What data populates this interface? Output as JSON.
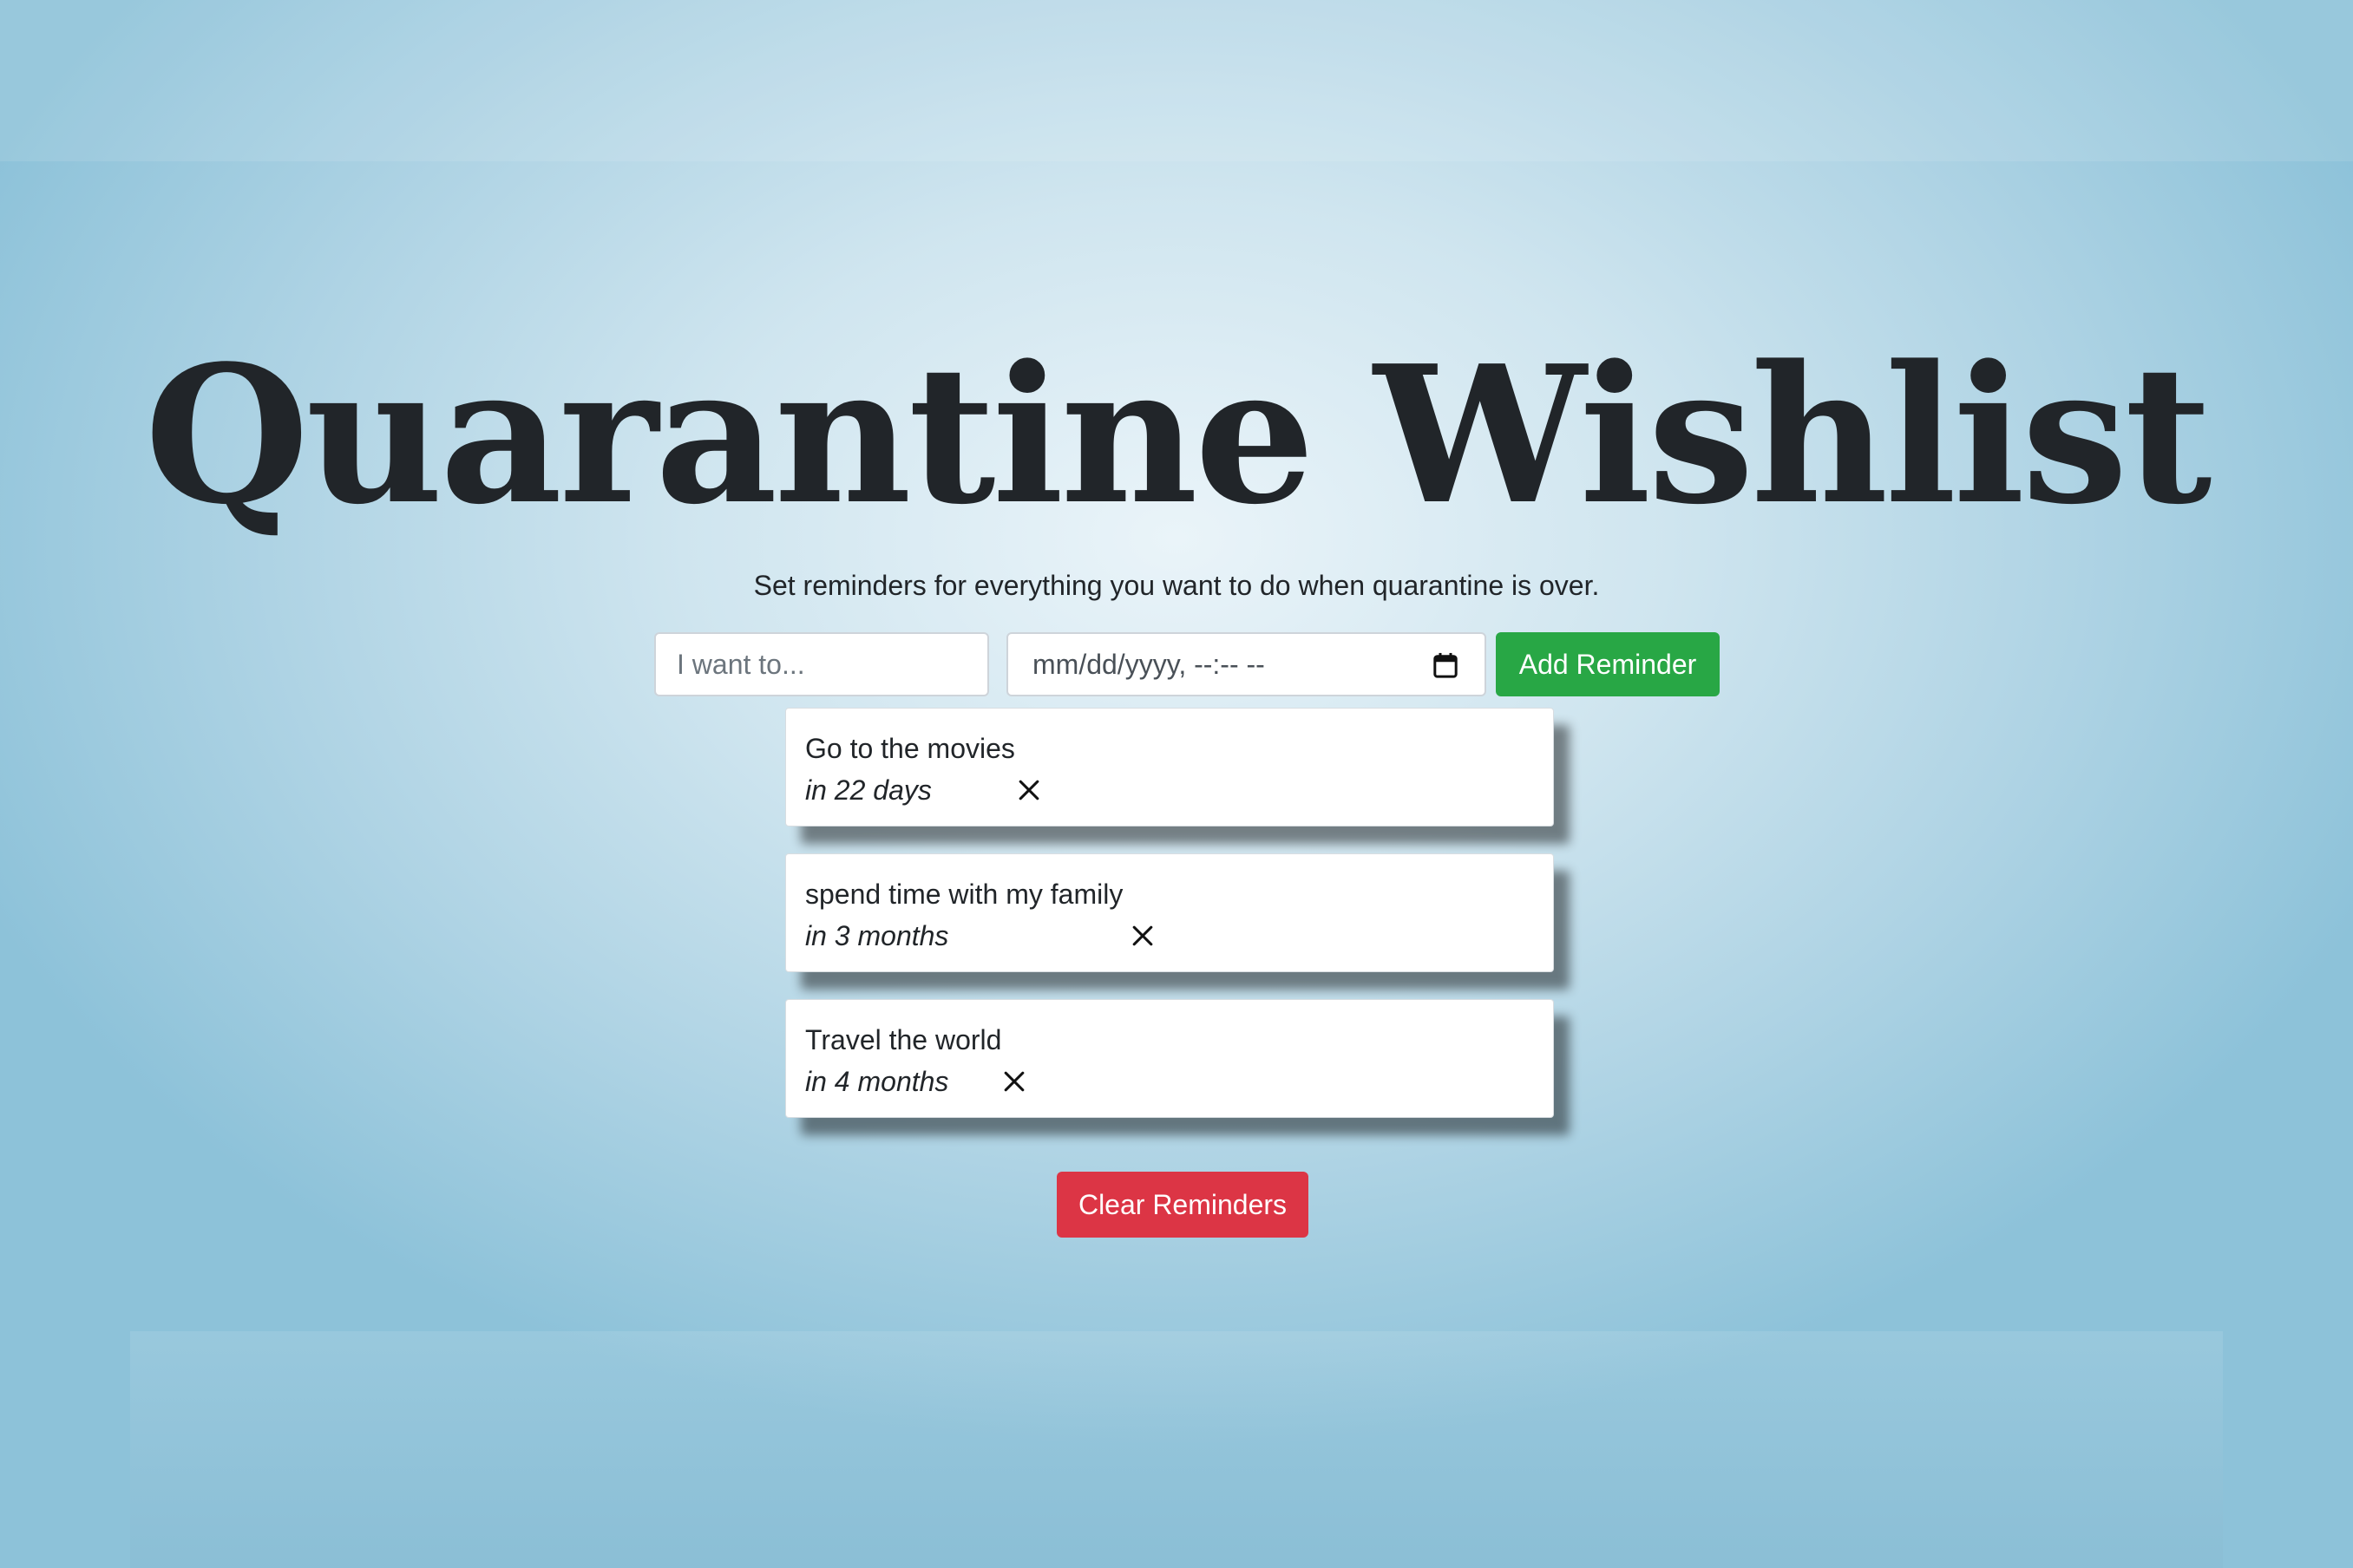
{
  "header": {
    "title": "Quarantine Wishlist",
    "subtitle": "Set reminders for everything you want to do when quarantine is over."
  },
  "form": {
    "task_placeholder": "I want to...",
    "date_placeholder": "mm/dd/yyyy, --:-- --",
    "date_icon": "calendar-icon",
    "add_label": "Add Reminder"
  },
  "reminders": [
    {
      "text": "Go to the movies",
      "when": "in 22 days",
      "delete_icon": "close-icon"
    },
    {
      "text": "spend time with my family",
      "when": "in 3 months",
      "delete_icon": "close-icon"
    },
    {
      "text": "Travel the world",
      "when": "in 4 months",
      "delete_icon": "close-icon"
    }
  ],
  "actions": {
    "clear_label": "Clear Reminders"
  },
  "colors": {
    "add_button": "#28a745",
    "clear_button": "#dc3545",
    "title_text": "#212529",
    "background": "#aed3e4"
  }
}
